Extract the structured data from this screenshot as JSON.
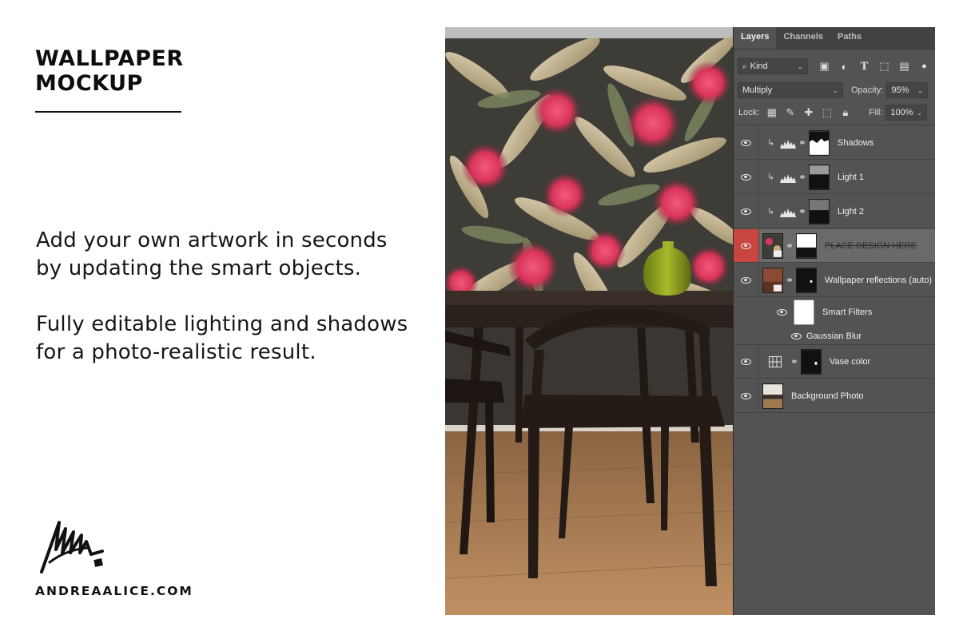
{
  "promo": {
    "title_line1": "WALLPAPER",
    "title_line2": "MOCKUP",
    "blurb1_line1": "Add your own artwork in seconds",
    "blurb1_line2": "by updating the smart objects.",
    "blurb2_line1": "Fully editable lighting and shadows",
    "blurb2_line2": "for a photo-realistic result.",
    "website": "ANDREAALICE.COM"
  },
  "layers_panel": {
    "tabs": [
      {
        "label": "Layers",
        "active": true
      },
      {
        "label": "Channels",
        "active": false
      },
      {
        "label": "Paths",
        "active": false
      }
    ],
    "filter_kind": "Kind",
    "blend_mode": "Multiply",
    "opacity_label": "Opacity:",
    "opacity_value": "95%",
    "lock_label": "Lock:",
    "fill_label": "Fill:",
    "fill_value": "100%",
    "layers": [
      {
        "name": "Shadows",
        "type": "adjustment"
      },
      {
        "name": "Light 1",
        "type": "adjustment"
      },
      {
        "name": "Light 2",
        "type": "adjustment"
      },
      {
        "name": "PLACE DESIGN HERE",
        "type": "smart-object",
        "selected": true
      },
      {
        "name": "Wallpaper reflections (auto)",
        "type": "smart-object"
      },
      {
        "name": "Vase color",
        "type": "adjustment"
      },
      {
        "name": "Background Photo",
        "type": "image"
      }
    ],
    "smart_filters_label": "Smart Filters",
    "gaussian_blur_label": "Gaussian Blur"
  },
  "colors": {
    "panel_bg": "#535353",
    "selected_eye": "#c8463f",
    "wallpaper_bg": "#3d3c37",
    "flower": "#e03a62"
  }
}
